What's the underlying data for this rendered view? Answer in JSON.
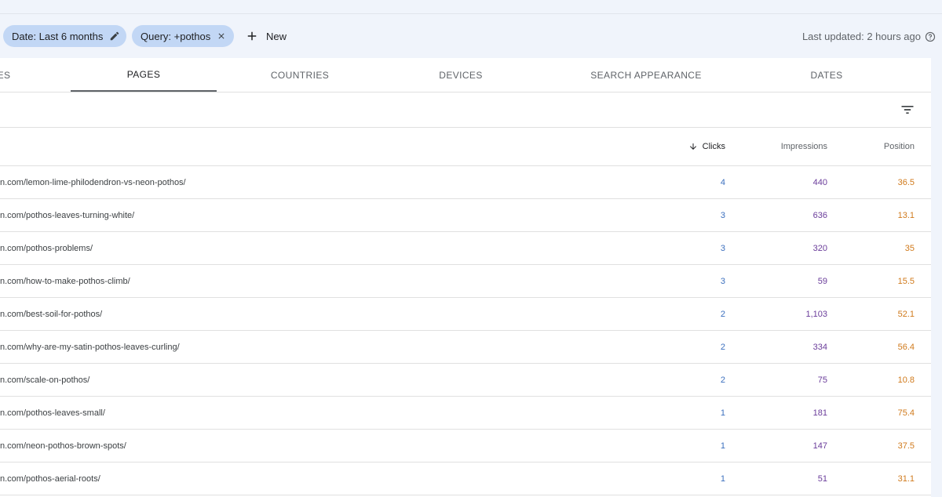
{
  "filters": {
    "date_chip": "Date: Last 6 months",
    "query_chip": "Query: +pothos",
    "new_label": "New",
    "last_updated": "Last updated: 2 hours ago"
  },
  "tabs": [
    {
      "label": "ES"
    },
    {
      "label": "PAGES"
    },
    {
      "label": "COUNTRIES"
    },
    {
      "label": "DEVICES"
    },
    {
      "label": "SEARCH APPEARANCE"
    },
    {
      "label": "DATES"
    }
  ],
  "active_tab": "PAGES",
  "table": {
    "headers": {
      "clicks": "Clicks",
      "impressions": "Impressions",
      "position": "Position"
    },
    "sorted_by": "Clicks",
    "rows": [
      {
        "url": "n.com/lemon-lime-philodendron-vs-neon-pothos/",
        "clicks": "4",
        "impressions": "440",
        "position": "36.5"
      },
      {
        "url": "n.com/pothos-leaves-turning-white/",
        "clicks": "3",
        "impressions": "636",
        "position": "13.1"
      },
      {
        "url": "n.com/pothos-problems/",
        "clicks": "3",
        "impressions": "320",
        "position": "35"
      },
      {
        "url": "n.com/how-to-make-pothos-climb/",
        "clicks": "3",
        "impressions": "59",
        "position": "15.5"
      },
      {
        "url": "n.com/best-soil-for-pothos/",
        "clicks": "2",
        "impressions": "1,103",
        "position": "52.1"
      },
      {
        "url": "n.com/why-are-my-satin-pothos-leaves-curling/",
        "clicks": "2",
        "impressions": "334",
        "position": "56.4"
      },
      {
        "url": "n.com/scale-on-pothos/",
        "clicks": "2",
        "impressions": "75",
        "position": "10.8"
      },
      {
        "url": "n.com/pothos-leaves-small/",
        "clicks": "1",
        "impressions": "181",
        "position": "75.4"
      },
      {
        "url": "n.com/neon-pothos-brown-spots/",
        "clicks": "1",
        "impressions": "147",
        "position": "37.5"
      },
      {
        "url": "n.com/pothos-aerial-roots/",
        "clicks": "1",
        "impressions": "51",
        "position": "31.1"
      }
    ]
  },
  "icons": {
    "edit": "pencil-icon",
    "remove": "close-icon",
    "add": "plus-icon",
    "help": "help-icon",
    "filter": "filter-icon",
    "sort": "arrow-down-icon"
  },
  "colors": {
    "chip_bg": "#c2d7f5",
    "clicks": "#3b6fbe",
    "impressions": "#6a3c9a",
    "position": "#d07a1c"
  }
}
